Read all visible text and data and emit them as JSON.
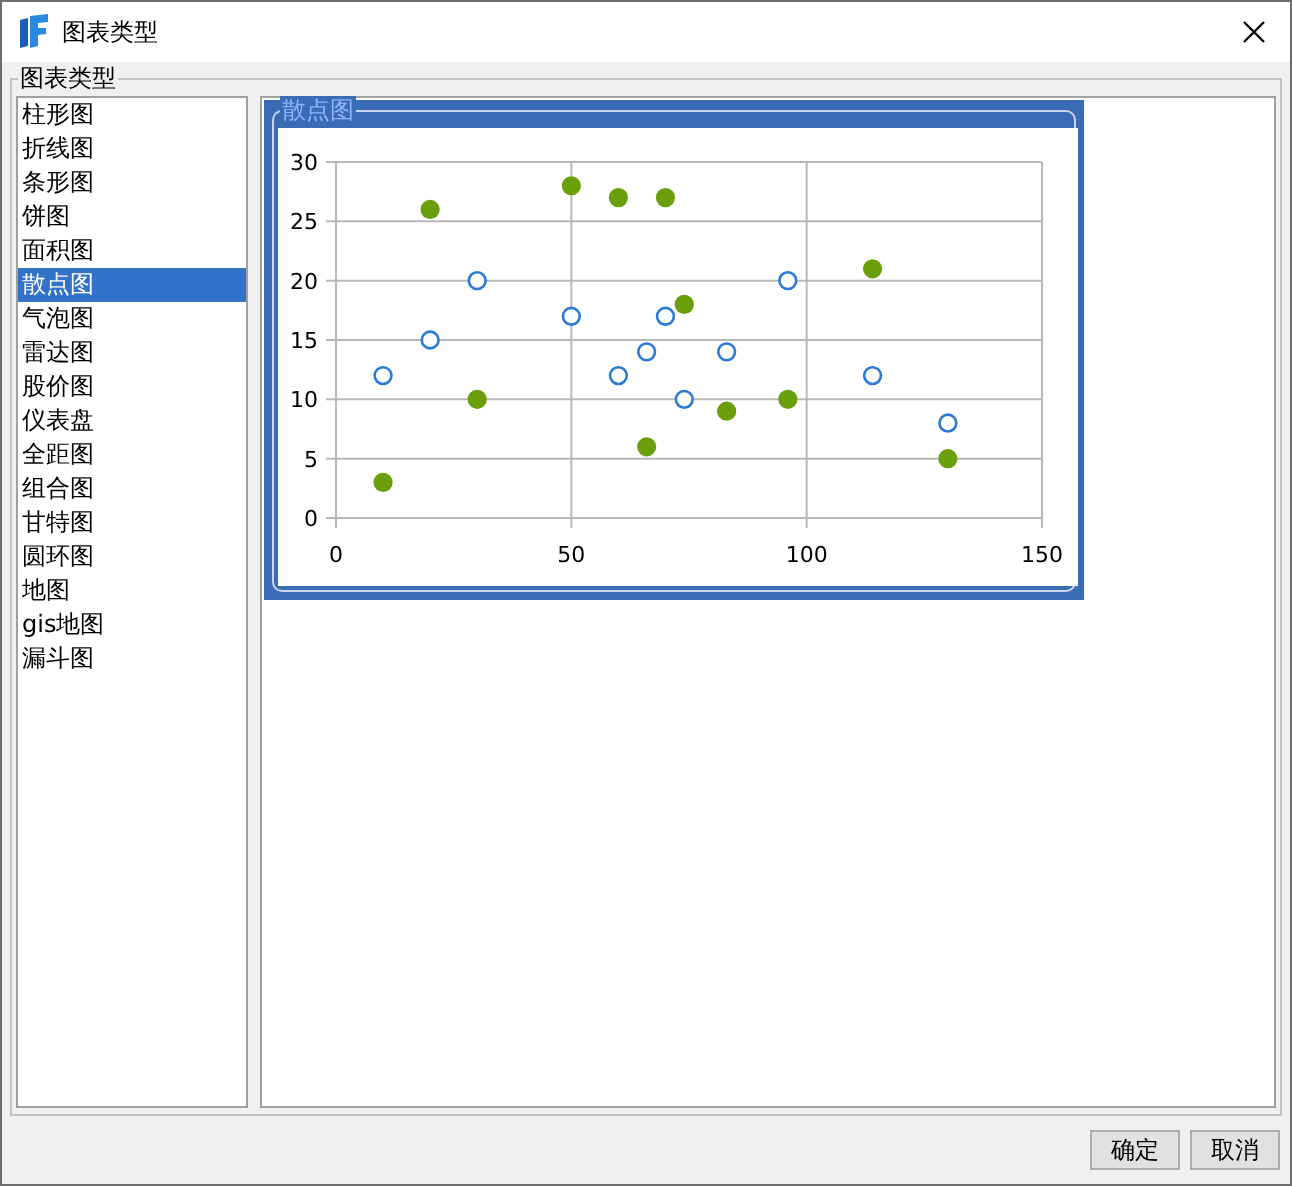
{
  "window": {
    "title": "图表类型"
  },
  "group_title": "图表类型",
  "chart_types": [
    {
      "label": "柱形图",
      "selected": false
    },
    {
      "label": "折线图",
      "selected": false
    },
    {
      "label": "条形图",
      "selected": false
    },
    {
      "label": "饼图",
      "selected": false
    },
    {
      "label": "面积图",
      "selected": false
    },
    {
      "label": "散点图",
      "selected": true
    },
    {
      "label": "气泡图",
      "selected": false
    },
    {
      "label": "雷达图",
      "selected": false
    },
    {
      "label": "股价图",
      "selected": false
    },
    {
      "label": "仪表盘",
      "selected": false
    },
    {
      "label": "全距图",
      "selected": false
    },
    {
      "label": "组合图",
      "selected": false
    },
    {
      "label": "甘特图",
      "selected": false
    },
    {
      "label": "圆环图",
      "selected": false
    },
    {
      "label": "地图",
      "selected": false
    },
    {
      "label": "gis地图",
      "selected": false
    },
    {
      "label": "漏斗图",
      "selected": false
    }
  ],
  "preview": {
    "title": "散点图",
    "chart_data": {
      "type": "scatter",
      "x": [
        10,
        20,
        30,
        50,
        60,
        66,
        70,
        74,
        83,
        96,
        114,
        130
      ],
      "series": [
        {
          "color": "#2a7ad6",
          "values": [
            12,
            15,
            20,
            17,
            12,
            14,
            17,
            10,
            14,
            20,
            12,
            8
          ]
        },
        {
          "color": "#6a9e0a",
          "values": [
            3,
            26,
            10,
            28,
            27,
            6,
            27,
            18,
            9,
            10,
            21,
            5
          ]
        }
      ],
      "grid": true,
      "xlim": [
        0,
        150
      ],
      "ylim": [
        0,
        30
      ],
      "xticks": [
        0,
        50,
        100,
        150
      ],
      "yticks": [
        0,
        5,
        10,
        15,
        20,
        25,
        30
      ]
    }
  },
  "buttons": [
    "确定",
    "取消"
  ]
}
